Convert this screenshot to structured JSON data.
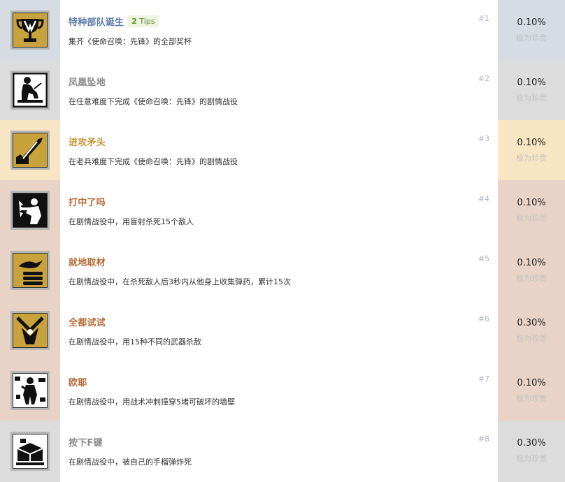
{
  "achievements": [
    {
      "num": "#1",
      "title": "特种部队诞生",
      "tips_count": "2",
      "tips_label": "Tips",
      "desc": "集齐《使命召唤：先锋》的全部奖杯",
      "pct": "0.10%",
      "rarity": "极为珍贵",
      "icon": "trophy-icon",
      "tier": "platinum",
      "tier_color": "#d6dbe4",
      "title_color": "#5b7aa8"
    },
    {
      "num": "#2",
      "title": "凤凰坠地",
      "desc": "在任意难度下完成《使命召唤：先锋》的剧情战役",
      "pct": "0.10%",
      "rarity": "极为珍贵",
      "icon": "soldier-sitting-icon",
      "tier": "silver",
      "tier_color": "#dcdcdc",
      "title_color": "#8a8a8a"
    },
    {
      "num": "#3",
      "title": "进攻矛头",
      "desc": "在老兵难度下完成《使命召唤：先锋》的剧情战役",
      "pct": "0.10%",
      "rarity": "极为珍贵",
      "icon": "spearhead-icon",
      "tier": "gold",
      "tier_color": "#f8e5c4",
      "title_color": "#c8943a"
    },
    {
      "num": "#4",
      "title": "打中了吗",
      "desc": "在剧情战役中，用盲射杀死15个敌人",
      "pct": "0.10%",
      "rarity": "极为珍贵",
      "icon": "blindfire-icon",
      "tier": "bronze",
      "tier_color": "#e8d3c6",
      "title_color": "#b56a38"
    },
    {
      "num": "#5",
      "title": "就地取材",
      "desc": "在剧情战役中，在杀死敌人后3秒内从他身上收集弹药，累计15次",
      "pct": "0.10%",
      "rarity": "极为珍贵",
      "icon": "ammo-bird-icon",
      "tier": "bronze",
      "tier_color": "#e8d3c6",
      "title_color": "#b56a38"
    },
    {
      "num": "#6",
      "title": "全都试试",
      "desc": "在剧情战役中，用15种不同的武器杀敌",
      "pct": "0.30%",
      "rarity": "极为珍贵",
      "icon": "weapons-icon",
      "tier": "bronze",
      "tier_color": "#e8d3c6",
      "title_color": "#b56a38"
    },
    {
      "num": "#7",
      "title": "欧耶",
      "desc": "在剧情战役中，用战术冲刺撞穿5堵可破坏的墙壁",
      "pct": "0.10%",
      "rarity": "极为珍贵",
      "icon": "wall-breach-icon",
      "tier": "bronze",
      "tier_color": "#e8d3c6",
      "title_color": "#b56a38"
    },
    {
      "num": "#8",
      "title": "按下F键",
      "desc": "在剧情战役中，被自己的手榴弹炸死",
      "pct": "0.30%",
      "rarity": "极为珍贵",
      "icon": "crate-icon",
      "tier": "silver",
      "tier_color": "#dcdcdc",
      "title_color": "#8a8a8a"
    }
  ]
}
